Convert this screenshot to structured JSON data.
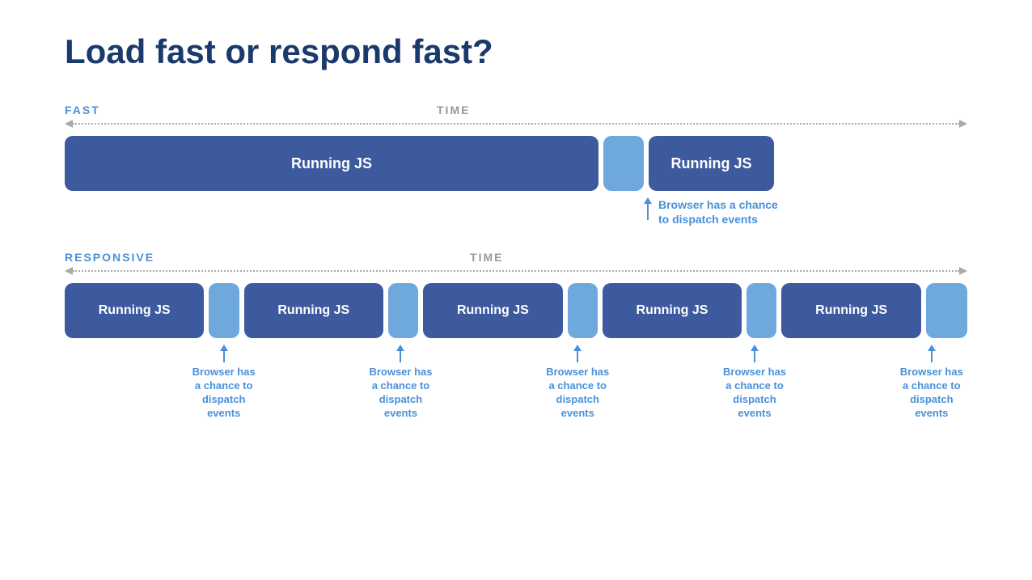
{
  "title": "Load fast or respond fast?",
  "fast_section": {
    "label": "FAST",
    "time_label": "TIME",
    "block1_label": "Running JS",
    "block2_label": "Running JS",
    "annotation": "Browser has a chance to dispatch events"
  },
  "responsive_section": {
    "label": "RESPONSIVE",
    "time_label": "TIME",
    "block_label": "Running JS",
    "annotation": "Browser has a chance to dispatch events"
  },
  "colors": {
    "dark_blue_block": "#3d5a9e",
    "light_blue_block": "#6fa8dc",
    "annotation_text": "#4a90d9",
    "title": "#1a3a6b"
  }
}
